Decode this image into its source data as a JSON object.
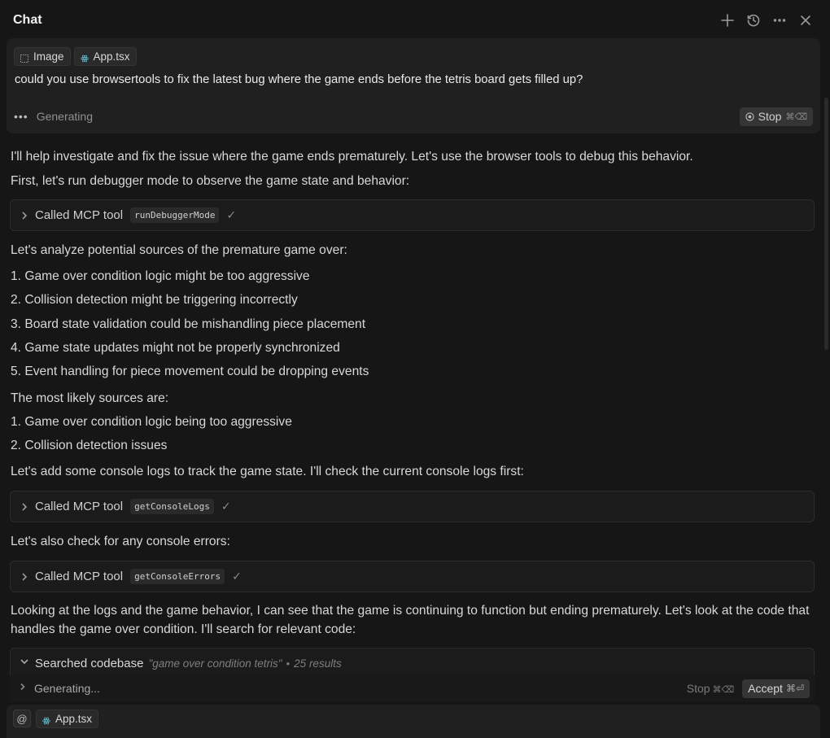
{
  "header": {
    "title": "Chat",
    "actions": [
      "plus-icon",
      "history-icon",
      "more-icon",
      "close-icon"
    ]
  },
  "user_message": {
    "attachments": [
      {
        "label": "Image",
        "icon": "image-icon"
      },
      {
        "label": "App.tsx",
        "icon": "react-file-icon"
      }
    ],
    "text": "could you use browsertools to fix the latest bug where the game ends before the tetris board gets filled up?",
    "status": "Generating",
    "stop_label": "Stop",
    "stop_shortcut": "⌘⌫"
  },
  "assistant": {
    "intro_1": "I'll help investigate and fix the issue where the game ends prematurely. Let's use the browser tools to debug this behavior.",
    "intro_2": "First, let's run debugger mode to observe the game state and behavior:",
    "tool_calls": [
      {
        "label": "Called MCP tool",
        "tool": "runDebuggerMode"
      },
      {
        "label": "Called MCP tool",
        "tool": "getConsoleLogs"
      },
      {
        "label": "Called MCP tool",
        "tool": "getConsoleErrors"
      }
    ],
    "analysis_heading": "Let's analyze potential sources of the premature game over:",
    "sources": [
      "1. Game over condition logic might be too aggressive",
      "2. Collision detection might be triggering incorrectly",
      "3. Board state validation could be mishandling piece placement",
      "4. Game state updates might not be properly synchronized",
      "5. Event handling for piece movement could be dropping events"
    ],
    "likely_heading": "The most likely sources are:",
    "likely": [
      "1. Game over condition logic being too aggressive",
      "2. Collision detection issues"
    ],
    "console_logs_text": "Let's add some console logs to track the game state. I'll check the current console logs first:",
    "console_errors_text": "Let's also check for any console errors:",
    "conclusion": "Looking at the logs and the game behavior, I can see that the game is continuing to function but ending prematurely. Let's look at the code that handles the game over condition. I'll search for relevant code:",
    "search": {
      "label": "Searched codebase",
      "query": "\"game over condition tetris\"",
      "separator": "•",
      "count": "25 results"
    }
  },
  "bottom_bar": {
    "status": "Generating...",
    "stop_label": "Stop",
    "stop_shortcut": "⌘⌫",
    "accept_label": "Accept",
    "accept_shortcut": "⌘⏎"
  },
  "composer": {
    "at_symbol": "@",
    "file_chip": "App.tsx"
  }
}
